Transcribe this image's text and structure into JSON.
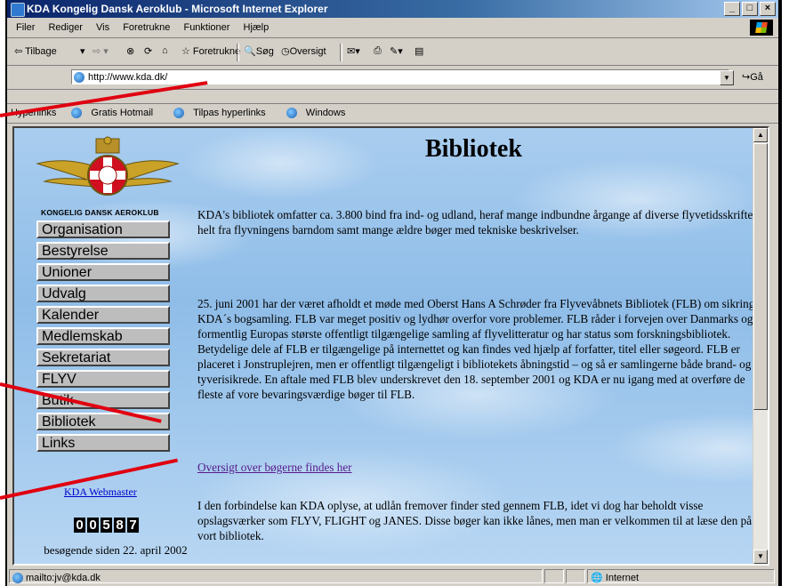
{
  "window": {
    "title": "KDA Kongelig Dansk Aeroklub - Microsoft Internet Explorer",
    "buttons": [
      "_",
      "□",
      "×"
    ]
  },
  "menu": [
    "Filer",
    "Rediger",
    "Vis",
    "Foretrukne",
    "Funktioner",
    "Hjælp"
  ],
  "toolbar": {
    "back": "⇦ Tilbage",
    "favorites": "Foretrukne",
    "search": "Søg",
    "history": "Oversigt"
  },
  "address": {
    "url": "http://www.kda.dk/",
    "go": "Gå"
  },
  "links": {
    "label": "Hyperlinks",
    "items": [
      "Gratis Hotmail",
      "Tilpas hyperlinks",
      "Windows"
    ]
  },
  "sidebar": {
    "club_name": "KONGELIG DANSK AEROKLUB",
    "nav": [
      "Organisation",
      "Bestyrelse",
      "Unioner",
      "Udvalg",
      "Kalender",
      "Medlemskab",
      "Sekretariat",
      "FLYV",
      "Butik",
      "Bibliotek",
      "Links"
    ],
    "webmaster": "KDA Webmaster",
    "counter": [
      "0",
      "0",
      "5",
      "8",
      "7"
    ],
    "visitors": "besøgende siden 22. april 2002"
  },
  "main": {
    "title": "Bibliotek",
    "para1": "KDA's bibliotek omfatter ca. 3.800 bind fra ind- og udland, heraf mange indbundne årgange af diverse flyvetidsskrifter helt fra flyvningens barndom samt mange ældre bøger med tekniske beskrivelser.",
    "para2": "25. juni 2001 har der været afholdt et møde med Oberst Hans A Schrøder fra Flyvevåbnets Bibliotek (FLB) om sikring af KDA´s bogsamling. FLB var meget positiv og lydhør overfor vore problemer. FLB råder i forvejen over Danmarks og formentlig Europas største offentligt tilgængelige samling af flyvelitteratur og har status som forskningsbibliotek. Betydelige dele af FLB er tilgængelige på internettet og kan findes ved hjælp af forfatter, titel eller søgeord. FLB er placeret i Jonstruplejren, men er offentligt tilgængeligt i bibliotekets åbningstid – og så er samlingerne både brand- og tyverisikrede. En aftale med FLB blev underskrevet den 18. september 2001 og KDA er nu igang med at overføre de fleste af vore bevaringsværdige bøger til FLB.",
    "link": "Oversigt over bøgerne findes her",
    "para3": "I den forbindelse kan KDA oplyse, at udlån fremover finder sted gennem FLB, idet vi dog har beholdt visse opslagsværker som FLYV, FLIGHT og JANES. Disse bøger kan ikke lånes, men man er velkommen til at læse den på vort bibliotek."
  },
  "status": {
    "text": "mailto:jv@kda.dk",
    "zone": "Internet"
  },
  "colors": {
    "annotation_lines": "#e00010",
    "link_visited": "#551a8b",
    "titlebar": "#0a246a"
  }
}
